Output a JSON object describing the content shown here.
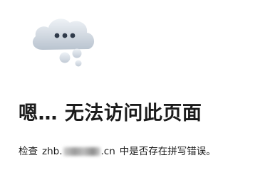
{
  "error_page": {
    "heading": "嗯… 无法访问此页面",
    "message": {
      "prefix": "检查",
      "url_start": "zhb.",
      "url_end": ".cn",
      "suffix": "中是否存在拼写错误。"
    },
    "illustration_icon": "thinking-cloud-icon"
  }
}
